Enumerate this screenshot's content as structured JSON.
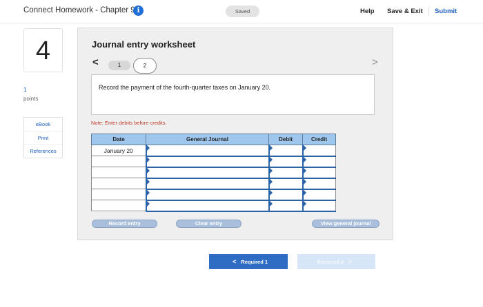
{
  "header": {
    "title": "Connect Homework - Chapter 9",
    "info_glyph": "i",
    "saved_label": "Saved",
    "help_label": "Help",
    "save_exit_label": "Save & Exit",
    "submit_label": "Submit"
  },
  "question": {
    "number": "4",
    "points_value": "1",
    "points_label": "points",
    "links": [
      "eBook",
      "Print",
      "References"
    ]
  },
  "worksheet": {
    "title": "Journal entry worksheet",
    "prev_glyph": "<",
    "next_glyph": ">",
    "tabs": [
      "1",
      "2"
    ],
    "active_tab": "2",
    "prompt": "Record the payment of the fourth-quarter taxes on January 20.",
    "note": "Note: Enter debits before credits.",
    "table": {
      "headers": [
        "Date",
        "General Journal",
        "Debit",
        "Credit"
      ],
      "rows": [
        {
          "date": "January 20",
          "account": "",
          "debit": "",
          "credit": ""
        },
        {
          "date": "",
          "account": "",
          "debit": "",
          "credit": ""
        },
        {
          "date": "",
          "account": "",
          "debit": "",
          "credit": ""
        },
        {
          "date": "",
          "account": "",
          "debit": "",
          "credit": ""
        },
        {
          "date": "",
          "account": "",
          "debit": "",
          "credit": ""
        },
        {
          "date": "",
          "account": "",
          "debit": "",
          "credit": ""
        }
      ]
    },
    "buttons": {
      "record": "Record entry",
      "clear": "Clear entry",
      "view": "View general journal"
    }
  },
  "footer_nav": {
    "required_1": "Required 1",
    "required_2": "Required 2"
  },
  "colors": {
    "brand_blue": "#2f6cc4",
    "table_header": "#9fc6ec",
    "note_red": "#c0392b"
  }
}
